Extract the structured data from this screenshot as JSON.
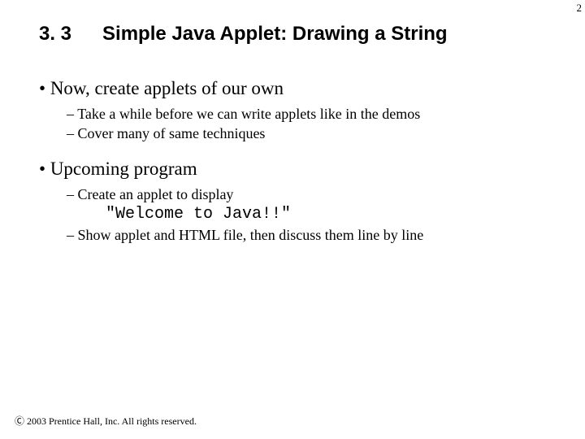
{
  "page_number": "2",
  "section_number": "3. 3",
  "section_title": "Simple Java Applet: Drawing a String",
  "bullets": {
    "b1": {
      "text": "Now, create applets of our own",
      "subs": [
        "Take a while before we can write applets like in the demos",
        "Cover many of same techniques"
      ]
    },
    "b2": {
      "text": "Upcoming program",
      "subs_a": [
        "Create an applet to display"
      ],
      "code": "\"Welcome to Java!!\"",
      "subs_b": [
        "Show applet and HTML file, then discuss them line by line"
      ]
    }
  },
  "footer": "Ⓒ 2003 Prentice Hall, Inc. All rights reserved."
}
